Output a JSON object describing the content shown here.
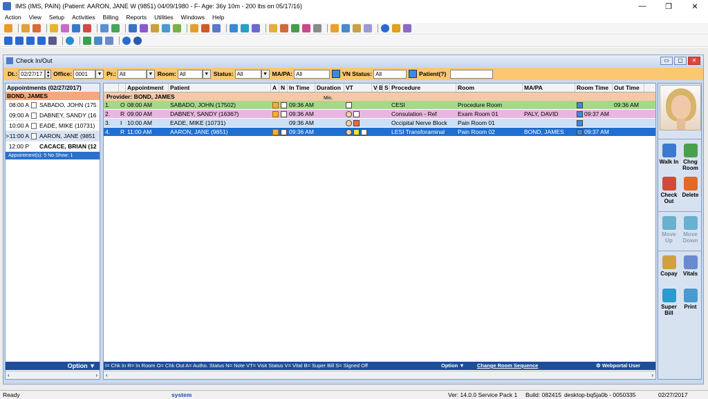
{
  "window": {
    "title": "IMS (IMS, PAIN)   (Patient: AARON, JANE W (9851) 04/09/1980 - F- Age: 36y 10m - 200 lbs on 05/17/16)",
    "controls": [
      "—",
      "❐",
      "✕"
    ]
  },
  "menu": [
    "Action",
    "View",
    "Setup",
    "Activities",
    "Billing",
    "Reports",
    "Utilities",
    "Windows",
    "Help"
  ],
  "child_window": {
    "title": "Check In/Out"
  },
  "filters": {
    "dt_label": "Dt.:",
    "dt_value": "02/27/17",
    "office_label": "Office:",
    "office_value": "0001",
    "pr_label": "Pr.:",
    "pr_value": "All",
    "room_label": "Room:",
    "room_value": "All",
    "status_label": "Status:",
    "status_value": "All",
    "mapa_label": "MA/PA:",
    "mapa_value": "All",
    "vn_label": "VN Status:",
    "vn_value": "All",
    "patient_label": "Patient(?)",
    "patient_value": ""
  },
  "left_panel": {
    "header": "Appointments (02/27/2017)",
    "provider": "BOND, JAMES",
    "items": [
      {
        "marker": "",
        "time": "08:00 A",
        "name": "SABADO, JOHN  (175"
      },
      {
        "marker": "",
        "time": "09:00 A",
        "name": "DABNEY, SANDY  (16"
      },
      {
        "marker": "",
        "time": "10:00 A",
        "name": "EADE, MIKE  (10731)"
      },
      {
        "marker": ">",
        "time": "11:00 A",
        "name": "AARON, JANE  (9851"
      },
      {
        "marker": "",
        "time": "12:00 P",
        "name": "CACACE, BRIAN  (12"
      }
    ],
    "summary": "Appointment(s): 5   No Show: 1",
    "option": "Option ▼"
  },
  "grid": {
    "columns": [
      "",
      "",
      "Appointment",
      "Patient",
      "A",
      "N",
      "In Time",
      "Duration",
      "VT",
      "V",
      "B",
      "S",
      "Procedure",
      "Room",
      "MA/PA",
      "Room Time",
      "Out Time"
    ],
    "provider": "Provider: BOND, JAMES",
    "min_label": "Min.",
    "rows": [
      {
        "num": "1.",
        "status": "O",
        "appt": "08:00 AM",
        "patient": "SABADO, JOHN  (17502)",
        "in_time": "09:36 AM",
        "procedure": "CESI",
        "room": "Procedure Room",
        "mapa": "",
        "room_time": "",
        "out_time": "09:36 AM"
      },
      {
        "num": "2.",
        "status": "R",
        "appt": "09:00 AM",
        "patient": "DABNEY, SANDY  (16367)",
        "in_time": "09:36 AM",
        "procedure": "Consulation - Ref",
        "room": "Exam Room 01",
        "mapa": "PALY, DAVID",
        "room_time": "09:37 AM",
        "out_time": ""
      },
      {
        "num": "3.",
        "status": "I",
        "appt": "10:00 AM",
        "patient": "EADE, MIKE  (10731)",
        "in_time": "09:36 AM",
        "procedure": "Occipital Nerve Block",
        "room": "Pain Room 01",
        "mapa": "",
        "room_time": "",
        "out_time": ""
      },
      {
        "num": "4.",
        "status": "R",
        "appt": "11:00 AM",
        "patient": "AARON, JANE  (9851)",
        "in_time": "09:36 AM",
        "procedure": "LESI Transforaminal",
        "room": "Pain Room 02",
        "mapa": "BOND, JAMES",
        "room_time": "09:37 AM",
        "out_time": ""
      }
    ],
    "legend": "I= Chk In  R= In Room O= Chk Out  A= Autho. Status  N= Note  VT= Visit Status  V= Vital  B= Super Bill  S= Signed Off",
    "option": "Option ▼",
    "change_room": "Change Room Sequence",
    "webportal": "Webportal User"
  },
  "actions": {
    "walk_in": "Walk In",
    "chng_room": "Chng Room",
    "check_out": "Check Out",
    "delete": "Delete",
    "move_up": "Move Up",
    "move_down": "Move Down",
    "copay": "Copay",
    "vitals": "Vitals",
    "super_bill": "Super Bill",
    "print": "Print"
  },
  "status": {
    "ready": "Ready",
    "user": "system",
    "version": "Ver: 14.0.0 Service Pack 1",
    "build": "Build: 082415",
    "host": "desktop-bq5ja0b - 0050335",
    "date": "02/27/2017"
  },
  "colors": {
    "filter_bg": "#fbc86f",
    "selected_row": "#1f6fd0",
    "row_out": "#a5d98a",
    "row_room": "#e8b6e0",
    "row_in": "#cbdff6"
  }
}
